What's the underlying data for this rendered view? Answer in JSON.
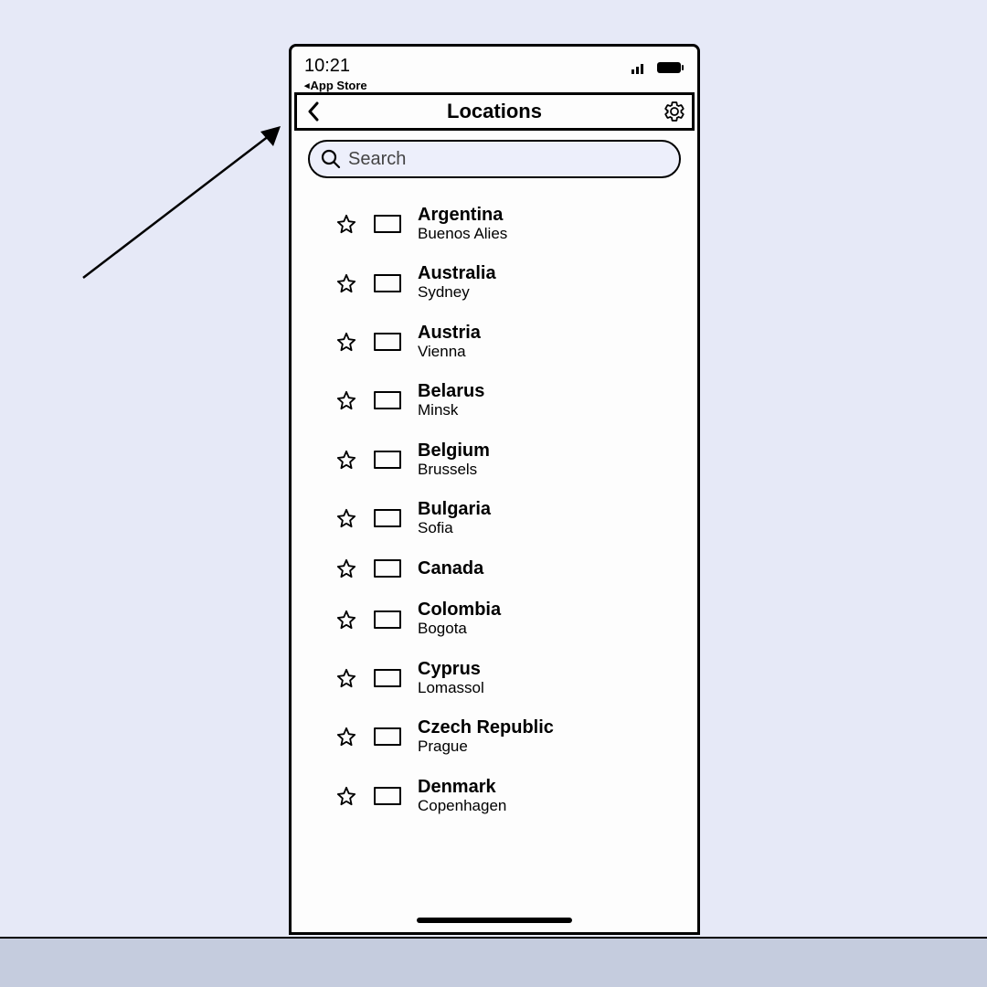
{
  "status": {
    "time": "10:21",
    "back_app": "App Store"
  },
  "nav": {
    "title": "Locations"
  },
  "search": {
    "placeholder": "Search"
  },
  "locations": [
    {
      "name": "Argentina",
      "city": "Buenos Alies"
    },
    {
      "name": "Australia",
      "city": "Sydney"
    },
    {
      "name": "Austria",
      "city": "Vienna"
    },
    {
      "name": "Belarus",
      "city": "Minsk"
    },
    {
      "name": "Belgium",
      "city": "Brussels"
    },
    {
      "name": "Bulgaria",
      "city": "Sofia"
    },
    {
      "name": "Canada",
      "city": ""
    },
    {
      "name": "Colombia",
      "city": "Bogota"
    },
    {
      "name": "Cyprus",
      "city": "Lomassol"
    },
    {
      "name": "Czech Republic",
      "city": "Prague"
    },
    {
      "name": "Denmark",
      "city": "Copenhagen"
    }
  ]
}
